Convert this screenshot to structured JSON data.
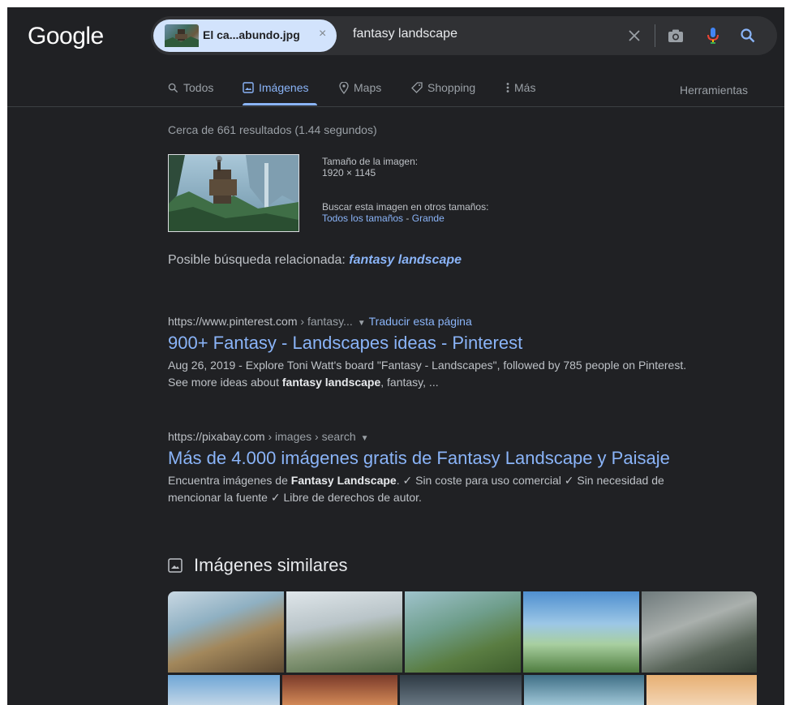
{
  "logo": "Google",
  "search": {
    "chip_filename": "El ca...abundo.jpg",
    "chip_close": "×",
    "query": "fantasy landscape"
  },
  "tabs": [
    {
      "label": "Todos",
      "icon": "search-icon"
    },
    {
      "label": "Imágenes",
      "icon": "image-icon",
      "active": true
    },
    {
      "label": "Maps",
      "icon": "map-pin-icon"
    },
    {
      "label": "Shopping",
      "icon": "tag-icon"
    },
    {
      "label": "Más",
      "icon": "more-vert-icon"
    }
  ],
  "tools_label": "Herramientas",
  "stats": "Cerca de 661 resultados (1.44 segundos)",
  "image_info": {
    "size_label": "Tamaño de la imagen:",
    "size_value": "1920 × 1145",
    "other_sizes_label": "Buscar esta imagen en otros tamaños:",
    "all_sizes_link": "Todos los tamaños",
    "dash": " - ",
    "large_link": "Grande"
  },
  "related": {
    "label": "Posible búsqueda relacionada:",
    "query": "fantasy landscape"
  },
  "results": [
    {
      "domain": "https://www.pinterest.com",
      "path": " › fantasy...",
      "translate": "Traducir esta página",
      "title": "900+ Fantasy - Landscapes ideas - Pinterest",
      "snippet_1": "Aug 26, 2019 - Explore Toni Watt's board \"Fantasy - Landscapes\", followed by 785 people on Pinterest. See more ideas about ",
      "snippet_bold": "fantasy landscape",
      "snippet_2": ", fantasy, ..."
    },
    {
      "domain": "https://pixabay.com",
      "path": " › images › search",
      "title": "Más de 4.000 imágenes gratis de Fantasy Landscape y Paisaje",
      "snippet_1": "Encuentra imágenes de ",
      "snippet_bold": "Fantasy Landscape",
      "snippet_2": ". ✓ Sin coste para uso comercial ✓ Sin necesidad de mencionar la fuente ✓ Libre de derechos de autor."
    }
  ],
  "similar_heading": "Imágenes similares",
  "colors": {
    "background": "#202124",
    "link": "#8ab4f8",
    "text": "#bdc1c6",
    "chip": "#d2e3fc"
  }
}
